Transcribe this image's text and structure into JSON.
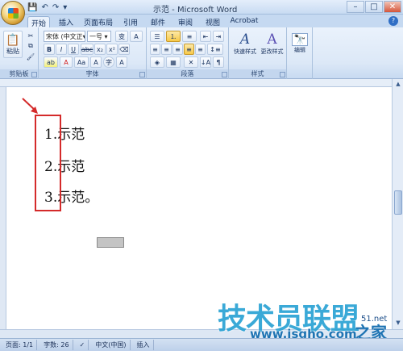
{
  "window": {
    "title": "示范 - Microsoft Word"
  },
  "qat": {
    "save": "💾",
    "undo": "↶",
    "redo": "↷",
    "more": "▾"
  },
  "tabs": [
    "开始",
    "插入",
    "页面布局",
    "引用",
    "邮件",
    "审阅",
    "视图",
    "Acrobat"
  ],
  "ribbon": {
    "clipboard": {
      "paste": "粘贴",
      "label": "剪贴板"
    },
    "font": {
      "font_name": "宋体 (中文正▾",
      "font_size": "一号 ▾",
      "grow": "A",
      "label": "字体"
    },
    "paragraph": {
      "label": "段落"
    },
    "styles": {
      "quick": "快速样式",
      "change": "更改样式",
      "label": "样式"
    },
    "editing": {
      "edit": "编辑"
    }
  },
  "document": {
    "lines": [
      "1.示范",
      "2.示范",
      "3.示范。"
    ]
  },
  "status": {
    "page": "页面: 1/1",
    "words": "字数: 26",
    "lang": "中文(中国)",
    "mode": "插入"
  },
  "watermark": {
    "main": "技术员联盟",
    "url": "www.jsgho.com",
    "suffix": "之家",
    "side": "51.net"
  },
  "colors": {
    "red_box": "#d42a2a",
    "ribbon_bg": "#dce8f7",
    "watermark": "#2aa2d4"
  }
}
